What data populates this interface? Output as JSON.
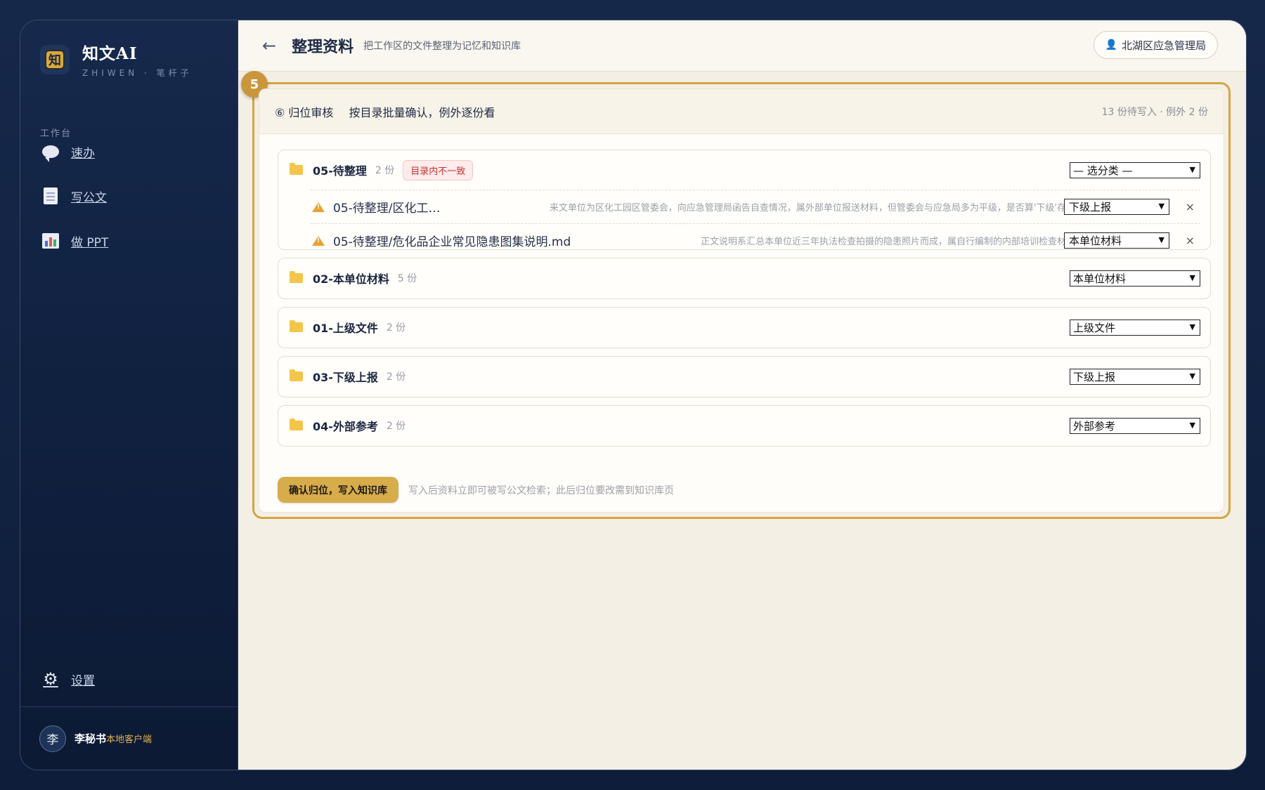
{
  "brand": {
    "name": "知文AI",
    "logo_char": "知",
    "subtitle": "ZHIWEN · 笔杆子"
  },
  "sidebar": {
    "section_label": "工作台",
    "items": [
      {
        "label": "速办",
        "icon": "chat-bubble-icon"
      },
      {
        "label": "写公文",
        "icon": "document-icon"
      },
      {
        "label": "做 PPT",
        "icon": "bar-chart-icon"
      }
    ],
    "settings_label": "设置",
    "user": {
      "avatar": "李",
      "name": "李秘书",
      "tag": "本地客户端"
    }
  },
  "header": {
    "back": "←",
    "title": "整理资料",
    "subtitle": "把工作区的文件整理为记忆和知识库",
    "org": "北湖区应急管理局"
  },
  "step_badge": "5",
  "panel": {
    "step_label": "⑥ 归位审核",
    "description": "按目录批量确认，例外逐份看",
    "stats": "13 份待写入 · 例外 2 份"
  },
  "groups": [
    {
      "name": "05-待整理",
      "count": "2 份",
      "badge": "目录内不一致",
      "select": "— 选分类 —",
      "files": [
        {
          "name": "05-待整理/区化工…",
          "note": "来文单位为区化工园区管委会，向应急管理局函告自查情况，属外部单位报送材料，但管委会与应急局多为平级，是否算'下级'存疑",
          "select": "下级上报",
          "remove": "×"
        },
        {
          "name": "05-待整理/危化品企业常见隐患图集说明.md",
          "note": "正文说明系汇总本单位近三年执法检查拍摄的隐患照片而成，属自行编制的内部培训检查材料",
          "select": "本单位材料",
          "remove": "×"
        }
      ]
    },
    {
      "name": "02-本单位材料",
      "count": "5 份",
      "select": "本单位材料"
    },
    {
      "name": "01-上级文件",
      "count": "2 份",
      "select": "上级文件"
    },
    {
      "name": "03-下级上报",
      "count": "2 份",
      "select": "下级上报"
    },
    {
      "name": "04-外部参考",
      "count": "2 份",
      "select": "外部参考"
    }
  ],
  "footer": {
    "confirm_label": "确认归位，写入知识库",
    "hint": "写入后资料立即可被写公文检索；此后归位要改需到知识库页"
  },
  "colors": {
    "accent": "#d6a441",
    "sidebar_bg": "#0f1f3d",
    "warning": "#e7a233",
    "danger": "#c8312e"
  }
}
